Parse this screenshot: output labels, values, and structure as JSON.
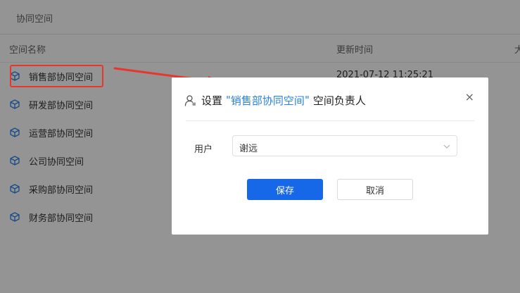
{
  "breadcrumb": "协同空间",
  "table": {
    "headers": {
      "name": "空间名称",
      "updated": "更新时间",
      "more": "大"
    },
    "rows": [
      {
        "name": "销售部协同空间",
        "time": "2021-07-12 11:25:21"
      },
      {
        "name": "研发部协同空间",
        "time": ""
      },
      {
        "name": "运营部协同空间",
        "time": ""
      },
      {
        "name": "公司协同空间",
        "time": ""
      },
      {
        "name": "采购部协同空间",
        "time": ""
      },
      {
        "name": "财务部协同空间",
        "time": ""
      }
    ]
  },
  "dialog": {
    "title_prefix": "设置",
    "quote_open": "\"",
    "space_name": "销售部协同空间",
    "quote_close": "\"",
    "title_suffix": "空间负责人",
    "close_glyph": "×",
    "field_label": "用户",
    "field_value": "谢远",
    "save_label": "保存",
    "cancel_label": "取消"
  },
  "icons": {
    "row_icon": "cube-icon",
    "title_icon": "user-icon",
    "select_icon": "chevron-down-icon",
    "close_icon": "close-icon"
  },
  "colors": {
    "accent": "#2a82e4",
    "primary_button": "#1768e9",
    "highlight_box": "#e8362d",
    "overlay": "rgba(0,0,0,0.42)"
  }
}
